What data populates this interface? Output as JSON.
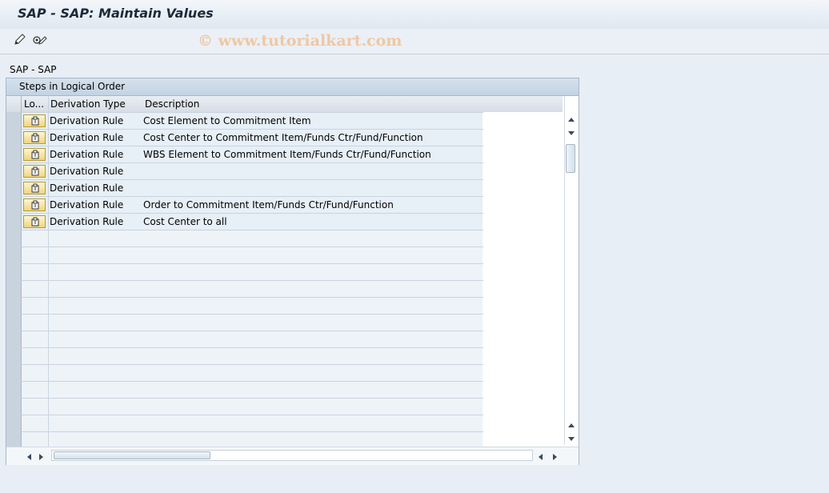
{
  "window": {
    "title": "SAP - SAP: Maintain Values"
  },
  "toolbar": {
    "buttons": [
      {
        "name": "change-icon"
      },
      {
        "name": "display-change-icon"
      }
    ],
    "watermark": "© www.tutorialkart.com"
  },
  "section": {
    "label": "SAP - SAP"
  },
  "panel": {
    "title": "Steps in Logical Order",
    "columns": [
      "Lo...",
      "Derivation Type",
      "Description"
    ],
    "rows": [
      {
        "type": "Derivation Rule",
        "description": "Cost Element to Commitment Item"
      },
      {
        "type": "Derivation Rule",
        "description": "Cost Center to Commitment Item/Funds Ctr/Fund/Function"
      },
      {
        "type": "Derivation Rule",
        "description": "WBS Element to Commitment Item/Funds Ctr/Fund/Function"
      },
      {
        "type": "Derivation Rule",
        "description": ""
      },
      {
        "type": "Derivation Rule",
        "description": ""
      },
      {
        "type": "Derivation Rule",
        "description": "Order to Commitment Item/Funds Ctr/Fund/Function"
      },
      {
        "type": "Derivation Rule",
        "description": "Cost Center to all"
      }
    ],
    "empty_rows": 13
  },
  "colors": {
    "row_bg": "#e7eff7",
    "header_bg": "#c3d3e3",
    "button_bg": "#f0d47f"
  }
}
